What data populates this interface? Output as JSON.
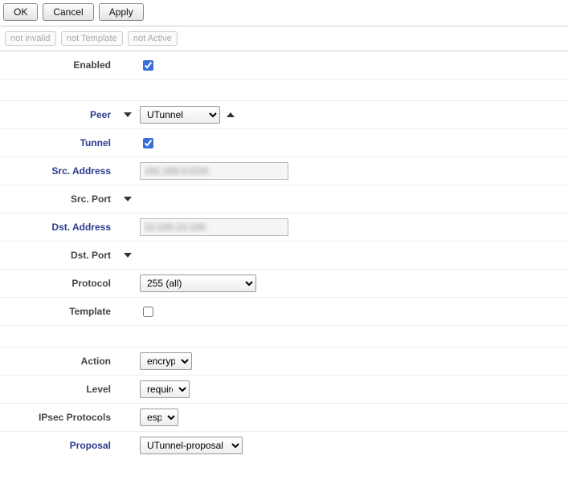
{
  "toolbar": {
    "ok": "OK",
    "cancel": "Cancel",
    "apply": "Apply"
  },
  "flags": {
    "invalid": "not invalid",
    "template": "not Template",
    "active": "not Active"
  },
  "labels": {
    "enabled": "Enabled",
    "peer": "Peer",
    "tunnel": "Tunnel",
    "src_address": "Src. Address",
    "src_port": "Src. Port",
    "dst_address": "Dst. Address",
    "dst_port": "Dst. Port",
    "protocol": "Protocol",
    "template": "Template",
    "action": "Action",
    "level": "Level",
    "ipsec_protocols": "IPsec Protocols",
    "proposal": "Proposal"
  },
  "values": {
    "enabled": true,
    "peer": "UTunnel",
    "tunnel": true,
    "src_address": "192.168.0.0/24",
    "dst_address": "10.100.10.100",
    "protocol": "255 (all)",
    "template": false,
    "action": "encrypt",
    "level": "require",
    "ipsec_protocols": "esp",
    "proposal": "UTunnel-proposal"
  }
}
